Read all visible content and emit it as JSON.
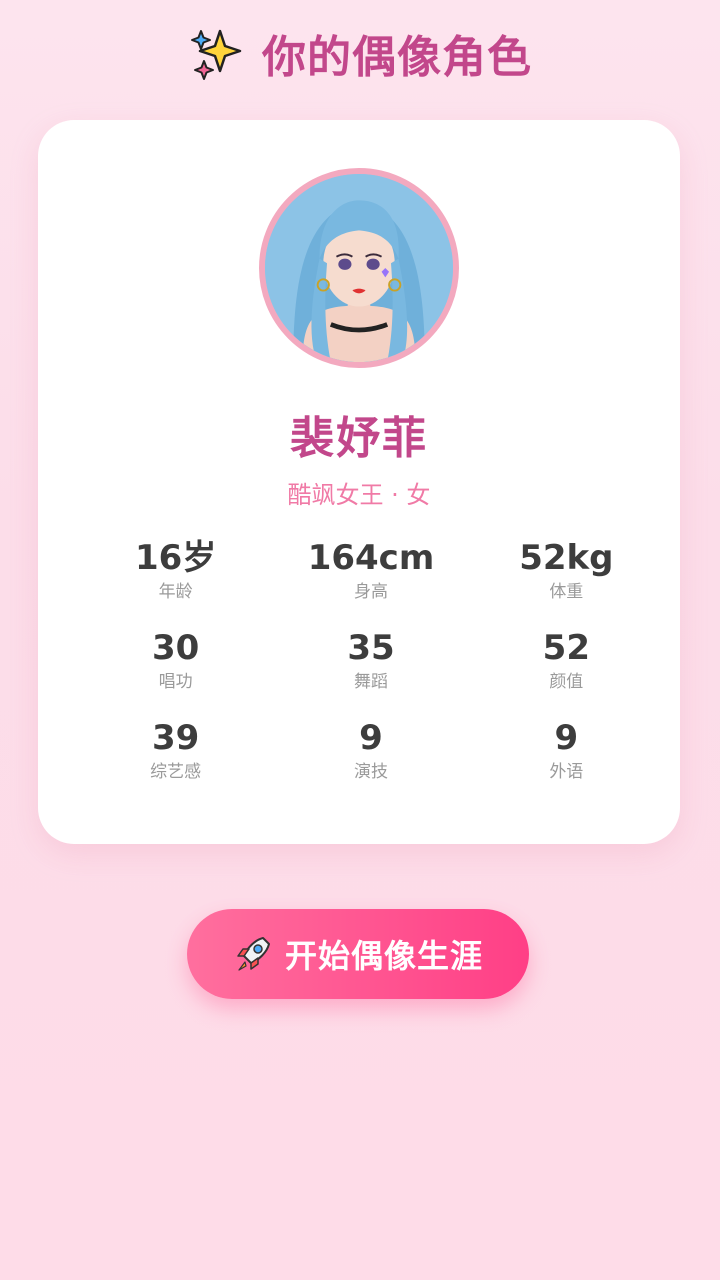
{
  "header": {
    "title": "你的偶像角色",
    "icon": "sparkles-icon"
  },
  "character": {
    "name": "裴妤菲",
    "subtitle": "酷飒女王 · 女",
    "avatar": "character-portrait"
  },
  "stats": [
    {
      "value": "16岁",
      "label": "年龄"
    },
    {
      "value": "164cm",
      "label": "身高"
    },
    {
      "value": "52kg",
      "label": "体重"
    },
    {
      "value": "30",
      "label": "唱功"
    },
    {
      "value": "35",
      "label": "舞蹈"
    },
    {
      "value": "52",
      "label": "颜值"
    },
    {
      "value": "39",
      "label": "综艺感"
    },
    {
      "value": "9",
      "label": "演技"
    },
    {
      "value": "9",
      "label": "外语"
    }
  ],
  "actions": {
    "start_label": "开始偶像生涯",
    "start_icon": "rocket-icon"
  },
  "colors": {
    "accent": "#c2478b",
    "subtitle": "#f07aa6",
    "button": "#ff4f8f",
    "background": "#fde4ee"
  }
}
